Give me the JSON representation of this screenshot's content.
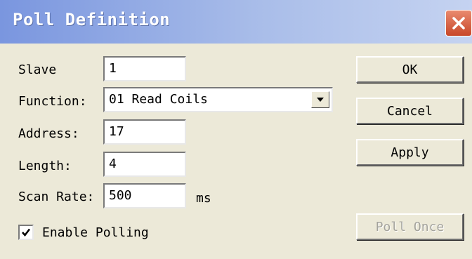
{
  "window": {
    "title": "Poll Definition",
    "close_icon": "close-icon"
  },
  "form": {
    "slave_label": "Slave",
    "slave_value": "1",
    "function_label": "Function:",
    "function_value": "01 Read Coils",
    "address_label": "Address:",
    "address_value": "17",
    "length_label": "Length:",
    "length_value": "4",
    "scan_rate_label": "Scan Rate:",
    "scan_rate_value": "500",
    "scan_rate_unit": "ms",
    "enable_polling_label": "Enable Polling",
    "enable_polling_checked": true
  },
  "buttons": {
    "ok": "OK",
    "cancel": "Cancel",
    "apply": "Apply",
    "poll_once": "Poll Once"
  },
  "colors": {
    "titlebar_start": "#7a96df",
    "titlebar_end": "#c5d3f1",
    "dialog_bg": "#ece9d8",
    "close_button": "#c8482a",
    "disabled_text": "#a4a39c"
  }
}
